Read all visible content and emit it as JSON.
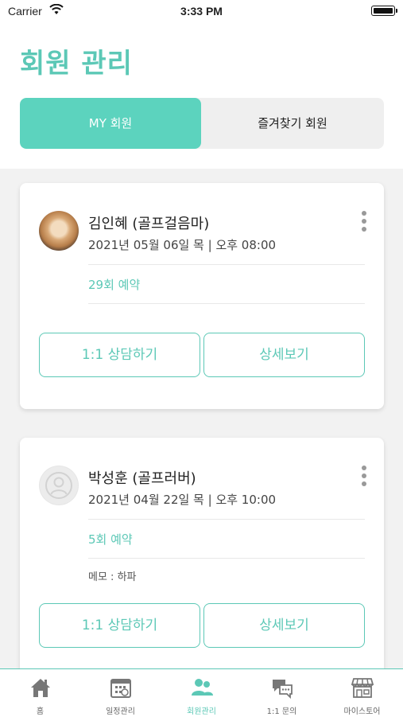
{
  "status_bar": {
    "carrier": "Carrier",
    "time": "3:33 PM"
  },
  "header": {
    "title": "회원 관리"
  },
  "segments": [
    {
      "label": "MY 회원",
      "selected": true
    },
    {
      "label": "즐겨찾기 회원",
      "selected": false
    }
  ],
  "members": [
    {
      "name": "김인혜 (골프걸음마)",
      "datetime": "2021년 05월 06일 목 | 오후 08:00",
      "reservations": "29회 예약",
      "memo": "",
      "consult_label": "1:1 상담하기",
      "detail_label": "상세보기"
    },
    {
      "name": "박성훈 (골프러버)",
      "datetime": "2021년 04월 22일 목 | 오후 10:00",
      "reservations": "5회 예약",
      "memo": "메모 : 하파",
      "consult_label": "1:1 상담하기",
      "detail_label": "상세보기"
    }
  ],
  "tabbar": {
    "items": [
      {
        "label": "홈",
        "icon": "home-icon"
      },
      {
        "label": "일정관리",
        "icon": "calendar-icon"
      },
      {
        "label": "회원관리",
        "icon": "members-icon",
        "active": true
      },
      {
        "label": "1:1 문의",
        "icon": "chat-icon"
      },
      {
        "label": "마이스토어",
        "icon": "store-icon"
      }
    ]
  },
  "colors": {
    "accent": "#5cc8b6",
    "segment_active": "#5cd3be",
    "background": "#f2f2f2"
  }
}
